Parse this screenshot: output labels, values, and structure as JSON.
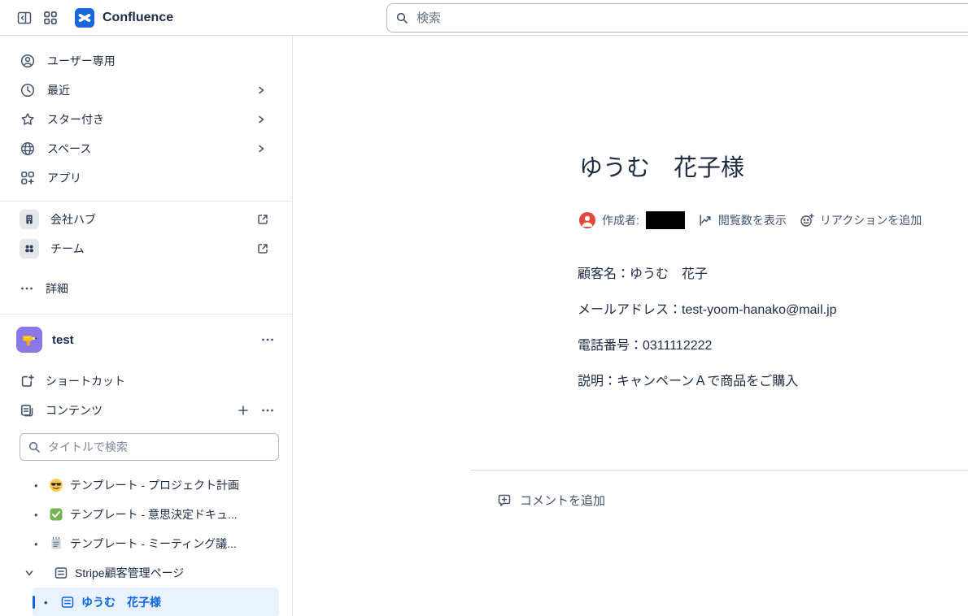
{
  "header": {
    "app_name": "Confluence",
    "search_placeholder": "検索"
  },
  "sidebar": {
    "nav": [
      {
        "label": "ユーザー専用",
        "icon": "user-circle-icon",
        "has_submenu": false
      },
      {
        "label": "最近",
        "icon": "clock-icon",
        "has_submenu": true
      },
      {
        "label": "スター付き",
        "icon": "star-icon",
        "has_submenu": true
      },
      {
        "label": "スペース",
        "icon": "globe-icon",
        "has_submenu": true
      },
      {
        "label": "アプリ",
        "icon": "apps-icon",
        "has_submenu": false
      }
    ],
    "links": [
      {
        "label": "会社ハブ",
        "icon": "building-icon",
        "external": true
      },
      {
        "label": "チーム",
        "icon": "people-icon",
        "external": true
      }
    ],
    "more_label": "詳細",
    "space": {
      "name": "test",
      "icon": "drill-emoji"
    },
    "space_nav": [
      {
        "label": "ショートカット",
        "icon": "shortcut-icon"
      },
      {
        "label": "コンテンツ",
        "icon": "pages-icon"
      }
    ],
    "content_search_placeholder": "タイトルで検索",
    "tree": [
      {
        "label": "テンプレート - プロジェクト計画",
        "icon": "sunglasses-face-emoji"
      },
      {
        "label": "テンプレート - 意思決定ドキュ...",
        "icon": "check-mark-emoji"
      },
      {
        "label": "テンプレート - ミーティング議...",
        "icon": "notepad-emoji"
      },
      {
        "label": "Stripe顧客管理ページ",
        "icon": "page-icon",
        "expanded": true
      },
      {
        "label": "ゆうむ　花子様",
        "icon": "page-icon",
        "selected": true
      }
    ]
  },
  "page": {
    "title": "ゆうむ　花子様",
    "byline": {
      "author_label": "作成者:",
      "author_name_redacted": true,
      "views_label": "閲覧数を表示",
      "reactions_label": "リアクションを追加"
    },
    "body": [
      "顧客名：ゆうむ　花子",
      "メールアドレス：test-yoom-hanako@mail.jp",
      "電話番号：0311112222",
      "説明：キャンペーンＡで商品をご購入"
    ],
    "comments": {
      "add_label": "コメントを追加"
    }
  },
  "colors": {
    "accent_blue": "#0C66E4",
    "logo_blue": "#1868DB",
    "selected_bg": "#E9F2FF",
    "avatar_red": "#E2483D",
    "space_tile_purple": "#8B77E8",
    "text": "#172B4D",
    "text_subtle": "#44546F"
  }
}
